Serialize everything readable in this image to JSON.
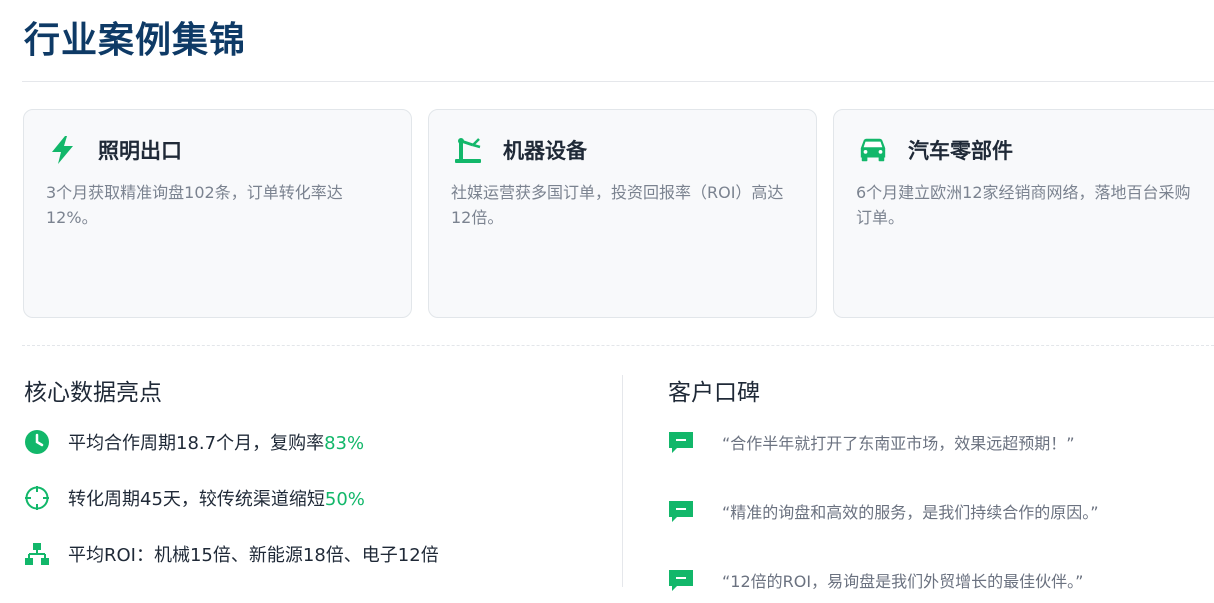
{
  "header": {
    "title": "行业案例集锦"
  },
  "cases": [
    {
      "icon": "lightning-icon",
      "title": "照明出口",
      "desc": "3个月获取精准询盘102条，订单转化率达12%。"
    },
    {
      "icon": "robotic-arm-icon",
      "title": "机器设备",
      "desc": "社媒运营获多国订单，投资回报率（ROI）高达12倍。"
    },
    {
      "icon": "car-icon",
      "title": "汽车零部件",
      "desc": "6个月建立欧洲12家经销商网络，落地百台采购订单。"
    }
  ],
  "stats_section": {
    "title": "核心数据亮点",
    "items": [
      {
        "icon": "clock-icon",
        "text": "平均合作周期18.7个月，复购率",
        "highlight": "83%"
      },
      {
        "icon": "crosshair-icon",
        "text": "转化周期45天，较传统渠道缩短",
        "highlight": "50%"
      },
      {
        "icon": "hierarchy-icon",
        "text": "平均ROI：机械15倍、新能源18倍、电子12倍",
        "highlight": ""
      }
    ]
  },
  "testimonials_section": {
    "title": "客户口碑",
    "items": [
      {
        "icon": "comment-icon",
        "text": "“合作半年就打开了东南亚市场，效果远超预期！”"
      },
      {
        "icon": "comment-icon",
        "text": "“精准的询盘和高效的服务，是我们持续合作的原因。”"
      },
      {
        "icon": "comment-icon",
        "text": "“12倍的ROI，易询盘是我们外贸增长的最佳伙伴。”"
      }
    ]
  },
  "colors": {
    "title": "#0e3a66",
    "accent": "#12b76a",
    "muted": "#7b8390"
  }
}
